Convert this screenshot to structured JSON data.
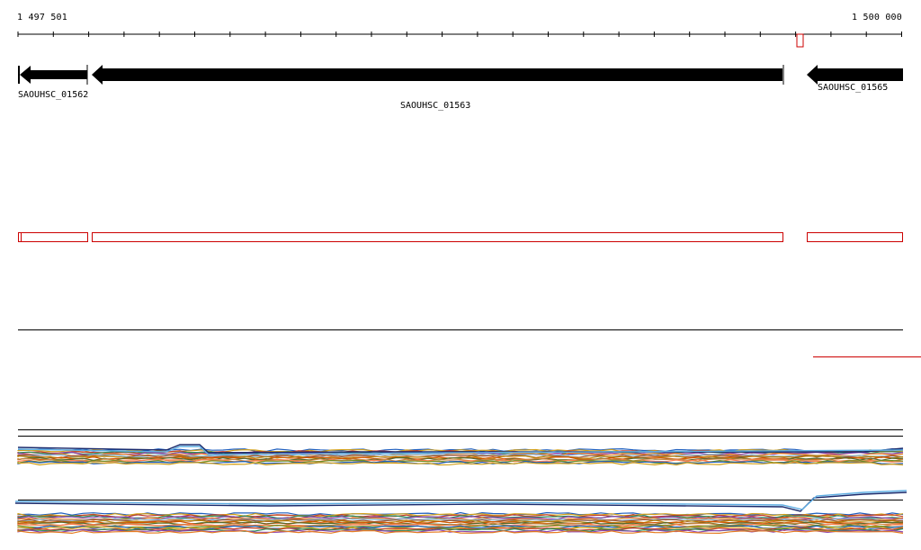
{
  "ruler": {
    "start_label": "1 497 501",
    "end_label": "1 500 000"
  },
  "genes": [
    {
      "id": "SAOUHSC_01562",
      "strand": "-"
    },
    {
      "id": "SAOUHSC_01563",
      "strand": "-"
    },
    {
      "id": "SAOUHSC_01565",
      "strand": "-"
    }
  ],
  "colors": {
    "gene_fill": "#000000",
    "feature_outline": "#cc0000",
    "track_line": "#000000"
  }
}
